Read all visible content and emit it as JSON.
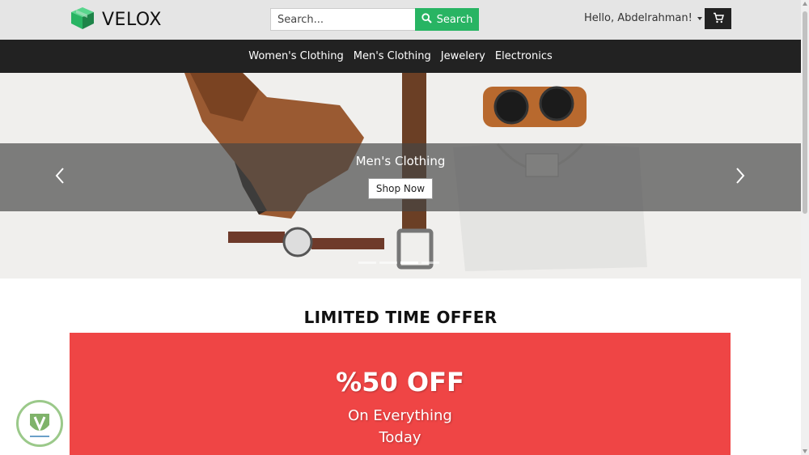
{
  "header": {
    "logo_text": "VELOX",
    "search_placeholder": "Search...",
    "search_button_label": "Search",
    "user_greeting": "Hello, Abdelrahman!"
  },
  "nav": {
    "items": [
      {
        "label": "Women's Clothing"
      },
      {
        "label": "Men's Clothing"
      },
      {
        "label": "Jewelery"
      },
      {
        "label": "Electronics"
      }
    ]
  },
  "hero": {
    "title": "Men's Clothing",
    "button_label": "Shop Now",
    "active_slide": 2,
    "slide_count": 4
  },
  "offer": {
    "heading": "LIMITED TIME OFFER",
    "discount": "%50 OFF",
    "line1": "On Everything",
    "line2": "Today"
  },
  "colors": {
    "search_button": "#28b463",
    "nav_bg": "#222222",
    "offer_bg": "#ef4545",
    "logo_green": "#2ecc71"
  },
  "icons": {
    "logo": "box-icon",
    "search": "search-icon",
    "cart": "cart-icon",
    "prev": "chevron-left-icon",
    "next": "chevron-right-icon"
  }
}
